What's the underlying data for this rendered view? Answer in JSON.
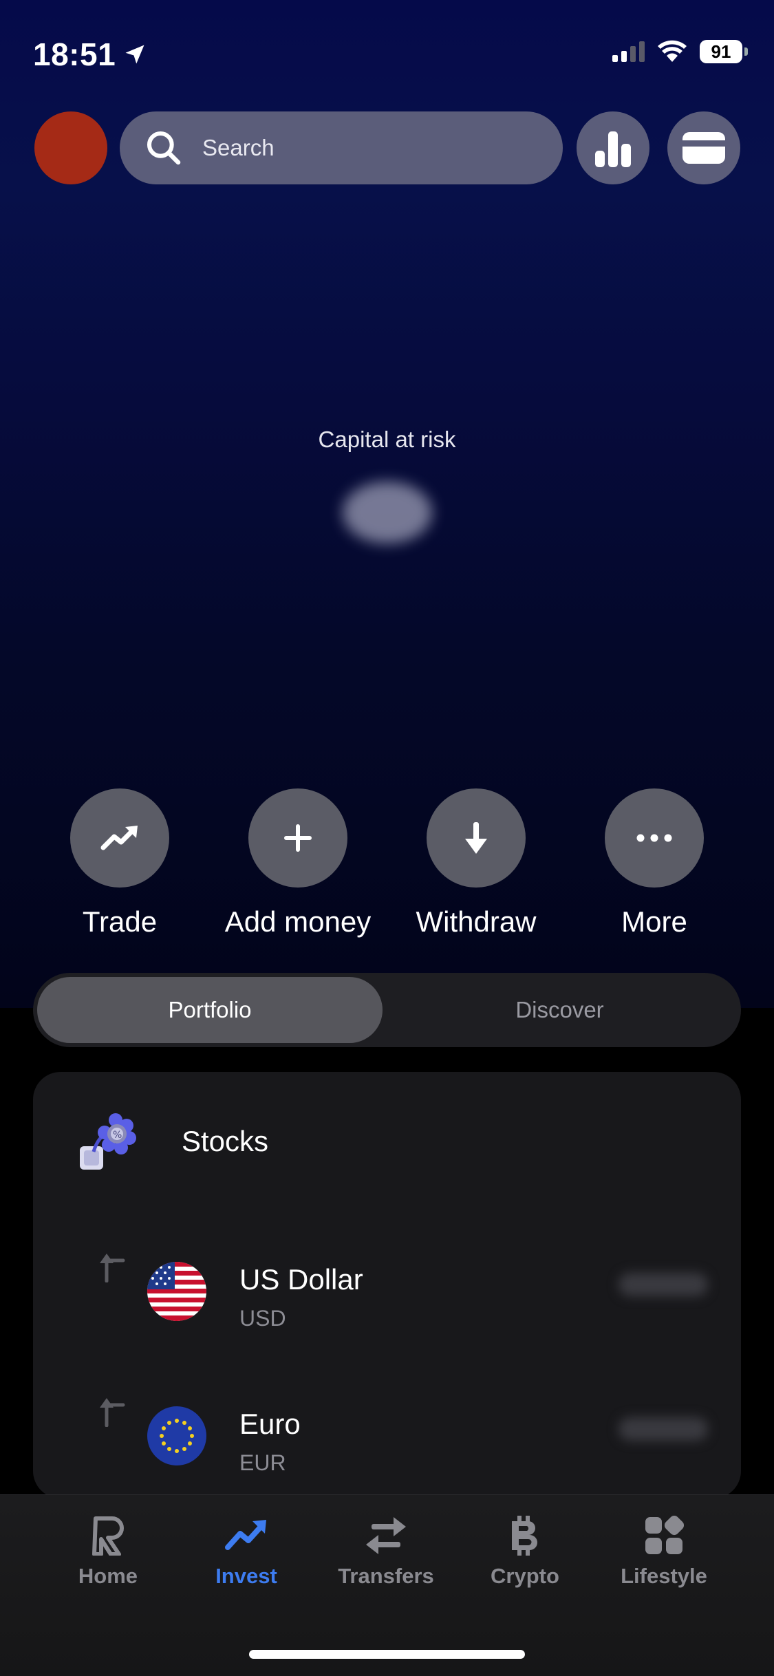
{
  "status_bar": {
    "time": "18:51",
    "battery": "91"
  },
  "top_bar": {
    "search_placeholder": "Search"
  },
  "hero": {
    "capital_notice": "Capital at risk"
  },
  "actions": [
    {
      "label": "Trade",
      "icon": "trend-up-icon"
    },
    {
      "label": "Add money",
      "icon": "plus-icon"
    },
    {
      "label": "Withdraw",
      "icon": "arrow-down-icon"
    },
    {
      "label": "More",
      "icon": "ellipsis-icon"
    }
  ],
  "segmented": {
    "portfolio": "Portfolio",
    "discover": "Discover",
    "selected": "Portfolio"
  },
  "stocks_card": {
    "title": "Stocks",
    "rows": [
      {
        "name": "US Dollar",
        "code": "USD"
      },
      {
        "name": "Euro",
        "code": "EUR"
      }
    ]
  },
  "tabbar": {
    "items": [
      {
        "label": "Home",
        "icon": "revolut-r-icon"
      },
      {
        "label": "Invest",
        "icon": "trend-up-icon",
        "active": true
      },
      {
        "label": "Transfers",
        "icon": "swap-arrows-icon"
      },
      {
        "label": "Crypto",
        "icon": "bitcoin-icon"
      },
      {
        "label": "Lifestyle",
        "icon": "grid-icon"
      }
    ],
    "active_color": "#3d7cf0"
  }
}
